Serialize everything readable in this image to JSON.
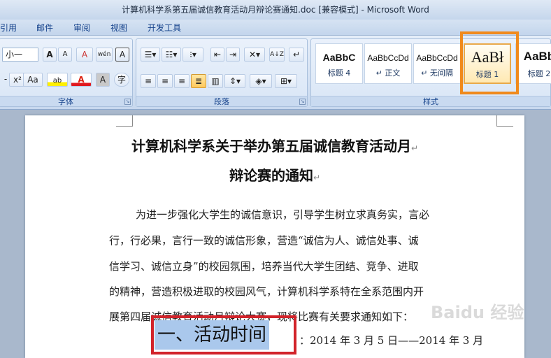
{
  "window": {
    "title": "计算机科学系第五届诚信教育活动月辩论赛通知.doc [兼容模式] - Microsoft Word"
  },
  "menu_tabs": [
    "引用",
    "邮件",
    "审阅",
    "视图",
    "开发工具"
  ],
  "ribbon": {
    "font": {
      "label": "字体",
      "size_value": "小一",
      "grow_font": "A",
      "shrink_font": "A",
      "clear_format": "A",
      "phonetic": "wén",
      "char_border": "A",
      "superscript": "x²",
      "change_case": "Aa",
      "highlight": "ab",
      "font_color": "A",
      "char_shading": "A",
      "enclose_char": "字"
    },
    "paragraph": {
      "label": "段落",
      "sort": "A↓Z"
    },
    "styles": {
      "label": "样式",
      "items": [
        {
          "sample": "AaBbC",
          "name": "标题 4"
        },
        {
          "sample": "AaBbCcDd",
          "name": "↵ 正文"
        },
        {
          "sample": "AaBbCcDd",
          "name": "↵ 无间隔"
        },
        {
          "sample": "AaBł",
          "name": "标题 1"
        },
        {
          "sample": "AaBb",
          "name": "标题 2"
        }
      ]
    }
  },
  "document": {
    "title_line1": "计算机科学系关于举办第五届诚信教育活动月",
    "title_line2": "辩论赛的通知",
    "paragraph_lines": [
      "为进一步强化大学生的诚信意识，引导学生树立求真务实，言必",
      "行，行必果，言行一致的诚信形象，营造“诚信为人、诚信处事、诚",
      "信学习、诚信立身”的校园氛围，培养当代大学生团结、竞争、进取",
      "的精神，营造积极进取的校园风气，计算机科学系特在全系范围内开",
      "展第四届诚信教育活动月辩论大赛，现将比赛有关要求通知如下："
    ],
    "heading": "一、活动时间",
    "heading_rest": "：2014 年 3 月 5 日——2014 年 3 月",
    "watermark": "Baidu 经验"
  },
  "colors": {
    "highlight_orange": "#f08a1c",
    "highlight_red": "#d2232a",
    "selection_blue": "#aac8ec"
  }
}
